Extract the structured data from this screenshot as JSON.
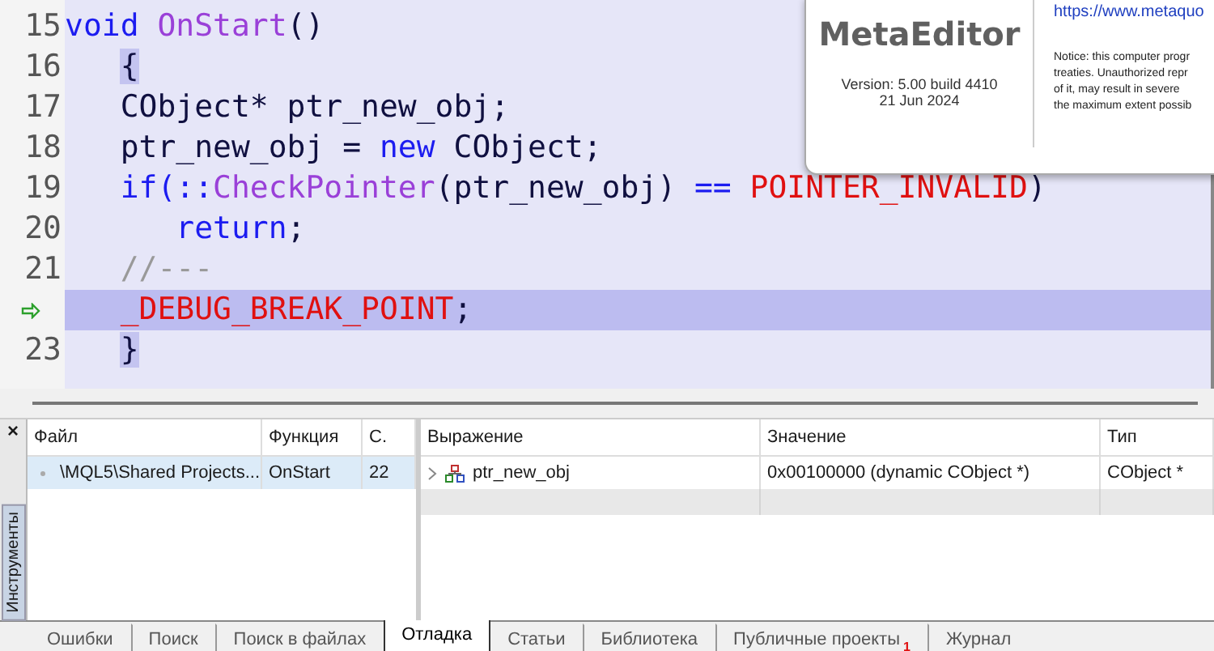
{
  "editor": {
    "lines": [
      {
        "number": "15",
        "current": false,
        "tokens": [
          {
            "text": "void ",
            "kind": "keyword"
          },
          {
            "text": "OnStart",
            "kind": "function"
          },
          {
            "text": "()",
            "kind": "plain"
          }
        ]
      },
      {
        "number": "16",
        "current": false,
        "tokens": [
          {
            "text": "   {",
            "kind": "brace_match"
          }
        ]
      },
      {
        "number": "17",
        "current": false,
        "tokens": [
          {
            "text": "   CObject* ptr_new_obj;",
            "kind": "plain"
          }
        ]
      },
      {
        "number": "18",
        "current": false,
        "tokens": [
          {
            "text": "   ptr_new_obj = ",
            "kind": "plain"
          },
          {
            "text": "new",
            "kind": "keyword"
          },
          {
            "text": " CObject;",
            "kind": "plain"
          }
        ]
      },
      {
        "number": "19",
        "current": false,
        "tokens": [
          {
            "text": "   if(::",
            "kind": "keyword"
          },
          {
            "text": "CheckPointer",
            "kind": "function"
          },
          {
            "text": "(ptr_new_obj) ",
            "kind": "plain"
          },
          {
            "text": "== ",
            "kind": "keyword"
          },
          {
            "text": "POINTER_INVALID",
            "kind": "constant"
          },
          {
            "text": ")",
            "kind": "plain"
          }
        ]
      },
      {
        "number": "20",
        "current": false,
        "tokens": [
          {
            "text": "      return",
            "kind": "keyword"
          },
          {
            "text": ";",
            "kind": "plain"
          }
        ]
      },
      {
        "number": "21",
        "current": false,
        "tokens": [
          {
            "text": "   //---",
            "kind": "comment"
          }
        ]
      },
      {
        "current": true,
        "tokens": [
          {
            "text": "   _DEBUG_BREAK_POINT",
            "kind": "constant"
          },
          {
            "text": ";",
            "kind": "plain"
          }
        ]
      },
      {
        "number": "23",
        "current": false,
        "tokens": [
          {
            "text": "   }",
            "kind": "brace_match"
          }
        ]
      }
    ]
  },
  "about_dialog": {
    "product": "MetaEditor",
    "version": "Version: 5.00 build 4410",
    "date": "21 Jun 2024",
    "link": "https://www.metaquo",
    "notice_lines": [
      "Notice: this computer progr",
      "treaties. Unauthorized repr",
      "of it, may result in severe",
      "the maximum extent possib"
    ]
  },
  "toolbox": {
    "close": "×",
    "side_tab": "Инструменты",
    "call_stack": {
      "columns": [
        "Файл",
        "Функция",
        "С."
      ],
      "rows": [
        {
          "file": "\\MQL5\\Shared Projects...",
          "function": "OnStart",
          "line": "22",
          "selected": true
        }
      ]
    },
    "watch": {
      "columns": [
        "Выражение",
        "Значение",
        "Тип"
      ],
      "rows": [
        {
          "expression": "ptr_new_obj",
          "value": "0x00100000 (dynamic CObject *)",
          "type": "CObject *",
          "expanded": false
        }
      ]
    },
    "tabs": [
      {
        "label": "Ошибки",
        "selected": false
      },
      {
        "label": "Поиск",
        "selected": false
      },
      {
        "label": "Поиск в файлах",
        "selected": false
      },
      {
        "label": "Отладка",
        "selected": true
      },
      {
        "label": "Статьи",
        "selected": false
      },
      {
        "label": "Библиотека",
        "selected": false
      },
      {
        "label": "Публичные проекты",
        "selected": false,
        "badge": "1"
      },
      {
        "label": "Журнал",
        "selected": false
      }
    ]
  }
}
